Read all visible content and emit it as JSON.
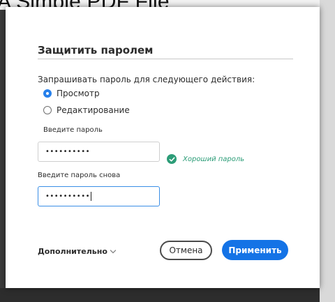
{
  "background": {
    "document_title": "A Simple PDF File"
  },
  "dialog": {
    "title": "Защитить паролем",
    "question": "Запрашивать пароль для следующего действия:",
    "options": [
      {
        "label": "Просмотр",
        "checked": true
      },
      {
        "label": "Редактирование",
        "checked": false
      }
    ],
    "password_label": "Введите пароль",
    "password_value": "••••••••••",
    "strength_text": "Хороший пароль",
    "confirm_label": "Введите пароль снова",
    "confirm_value": "••••••••••",
    "more_label": "Дополнительно",
    "cancel_label": "Отмена",
    "apply_label": "Применить"
  },
  "colors": {
    "accent": "#1473e6",
    "radio_selected": "#2680eb",
    "success": "#2d9d78",
    "focus_border": "#3a8ee6"
  },
  "icons": {
    "check": "check-circle-icon",
    "chevron": "chevron-down-icon"
  }
}
